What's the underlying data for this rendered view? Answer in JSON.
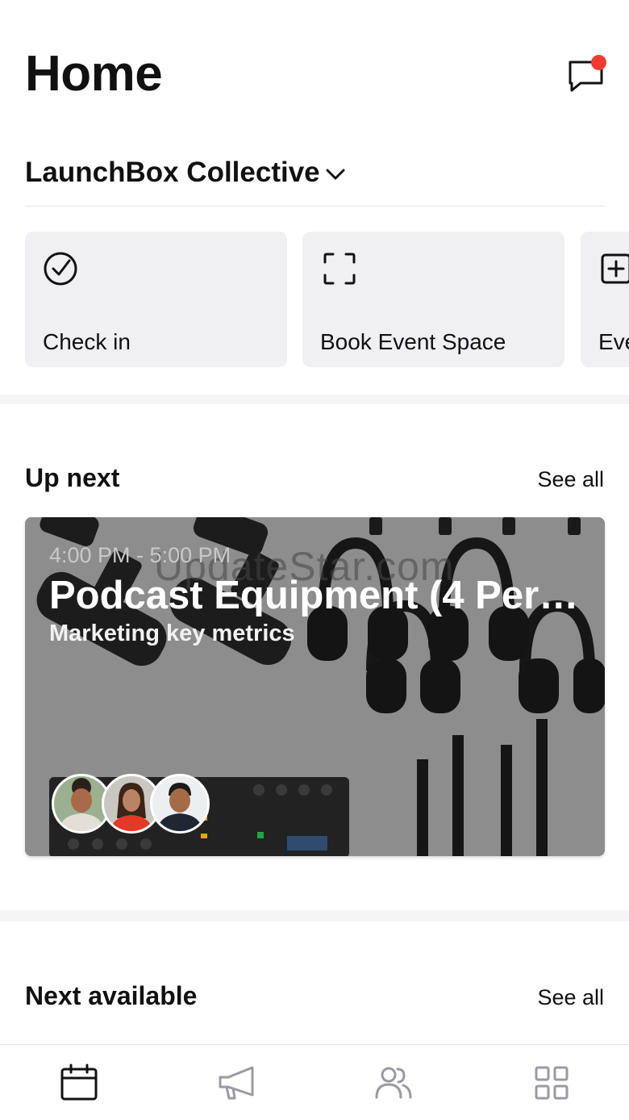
{
  "header": {
    "title": "Home",
    "messages_icon": "chat-bubble-icon",
    "has_unread": true,
    "unread_color": "#f43a2e"
  },
  "org": {
    "name": "LaunchBox Collective"
  },
  "quick_actions": [
    {
      "label": "Check in",
      "icon": "check-circle-icon"
    },
    {
      "label": "Book Event Space",
      "icon": "scan-frame-icon"
    },
    {
      "label": "Eve",
      "icon": "plus-square-icon"
    }
  ],
  "up_next": {
    "title": "Up next",
    "see_all": "See all",
    "event": {
      "time": "4:00 PM - 5:00 PM",
      "title": "Podcast Equipment (4 Per…",
      "subtitle": "Marketing key metrics",
      "watermark": "UpdateStar.com",
      "attendees": [
        "attendee-1",
        "attendee-2",
        "attendee-3"
      ]
    }
  },
  "next_available": {
    "title": "Next available",
    "see_all": "See all"
  },
  "tabbar": {
    "tabs": [
      {
        "name": "calendar",
        "icon": "calendar-icon",
        "active": true
      },
      {
        "name": "announcements",
        "icon": "megaphone-icon",
        "active": false
      },
      {
        "name": "community",
        "icon": "people-icon",
        "active": false
      },
      {
        "name": "more",
        "icon": "grid-icon",
        "active": false
      }
    ]
  },
  "colors": {
    "active_tab": "#111111",
    "inactive_tab": "#9a9aa0",
    "card_bg": "#f0f0f3"
  }
}
